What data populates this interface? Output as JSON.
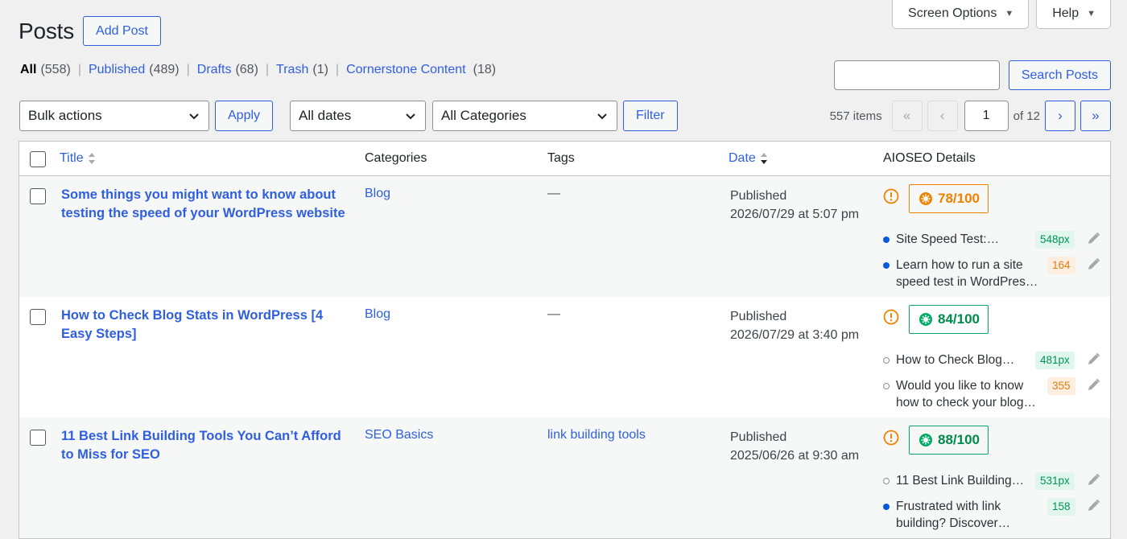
{
  "screen_meta": {
    "screen_options_label": "Screen Options",
    "help_label": "Help"
  },
  "header": {
    "title": "Posts",
    "add_post_label": "Add Post"
  },
  "views": [
    {
      "label": "All",
      "count": "(558)",
      "current": true
    },
    {
      "label": "Published",
      "count": "(489)"
    },
    {
      "label": "Drafts",
      "count": "(68)"
    },
    {
      "label": "Trash",
      "count": "(1)"
    },
    {
      "label": "Cornerstone Content",
      "count": "(18)"
    }
  ],
  "search": {
    "value": "",
    "button_label": "Search Posts"
  },
  "tablenav": {
    "bulk_actions": "Bulk actions",
    "apply_label": "Apply",
    "dates_filter": "All dates",
    "categories_filter": "All Categories",
    "filter_label": "Filter",
    "items_count": "557 items",
    "first_page": "«",
    "prev_page": "‹",
    "current_page": "1",
    "of_pages": "of 12",
    "next_page": "›",
    "last_page": "»"
  },
  "columns": {
    "title": "Title",
    "categories": "Categories",
    "tags": "Tags",
    "date": "Date",
    "aioseo": "AIOSEO Details"
  },
  "rows": [
    {
      "title": "Some things you might want to know about testing the speed of your WordPress website",
      "category": "Blog",
      "tags": "—",
      "status": "Published",
      "date": "2026/07/29 at 5:07 pm",
      "score": "78/100",
      "score_color": "#f18200",
      "seo_title": "Site Speed Test:…",
      "seo_title_badge": "548px",
      "seo_desc": "Learn how to run a site speed test in WordPres…",
      "seo_desc_badge": "164"
    },
    {
      "title": "How to Check Blog Stats in WordPress [4 Easy Steps]",
      "category": "Blog",
      "tags": "—",
      "status": "Published",
      "date": "2026/07/29 at 3:40 pm",
      "score": "84/100",
      "score_color": "#00aa63",
      "seo_title": "How to Check Blog…",
      "seo_title_badge": "481px",
      "seo_desc": "Would you like to know how to check your blog…",
      "seo_desc_badge": "355"
    },
    {
      "title": "11 Best Link Building Tools You Can’t Afford to Miss for SEO",
      "category": "SEO Basics",
      "tags": "link building tools",
      "status": "Published",
      "date": "2025/06/26 at 9:30 am",
      "score": "88/100",
      "score_color": "#00aa63",
      "seo_title": "11 Best Link Building…",
      "seo_title_badge": "531px",
      "seo_desc": "Frustrated with link building? Discover…",
      "seo_desc_badge": "158"
    }
  ],
  "icons": {
    "warning": "warning-circle-icon",
    "score": "aioseo-gear-icon",
    "edit": "pencil-icon",
    "sort": "sort-arrows-icon",
    "dropdown": "chevron-down-icon"
  }
}
